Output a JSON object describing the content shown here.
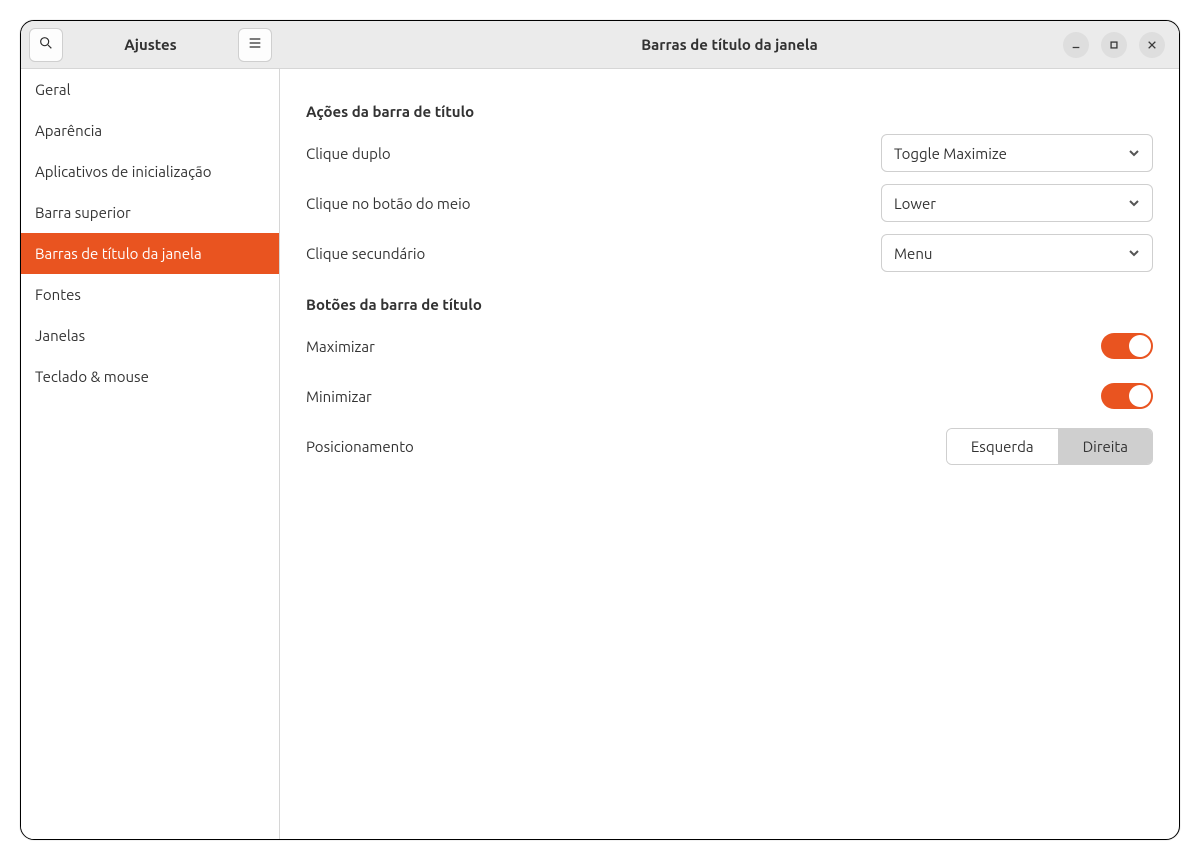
{
  "colors": {
    "accent": "#e95420"
  },
  "header": {
    "sidebar_title": "Ajustes",
    "main_title": "Barras de título da janela"
  },
  "sidebar": {
    "items": [
      {
        "label": "Geral",
        "active": false
      },
      {
        "label": "Aparência",
        "active": false
      },
      {
        "label": "Aplicativos de inicialização",
        "active": false
      },
      {
        "label": "Barra superior",
        "active": false
      },
      {
        "label": "Barras de título da janela",
        "active": true
      },
      {
        "label": "Fontes",
        "active": false
      },
      {
        "label": "Janelas",
        "active": false
      },
      {
        "label": "Teclado & mouse",
        "active": false
      }
    ]
  },
  "content": {
    "section1_title": "Ações da barra de título",
    "double_click_label": "Clique duplo",
    "double_click_value": "Toggle Maximize",
    "middle_click_label": "Clique no botão do meio",
    "middle_click_value": "Lower",
    "secondary_click_label": "Clique secundário",
    "secondary_click_value": "Menu",
    "section2_title": "Botões da barra de título",
    "maximize_label": "Maximizar",
    "maximize_on": true,
    "minimize_label": "Minimizar",
    "minimize_on": true,
    "placement_label": "Posicionamento",
    "placement_left": "Esquerda",
    "placement_right": "Direita",
    "placement_active": "right"
  }
}
